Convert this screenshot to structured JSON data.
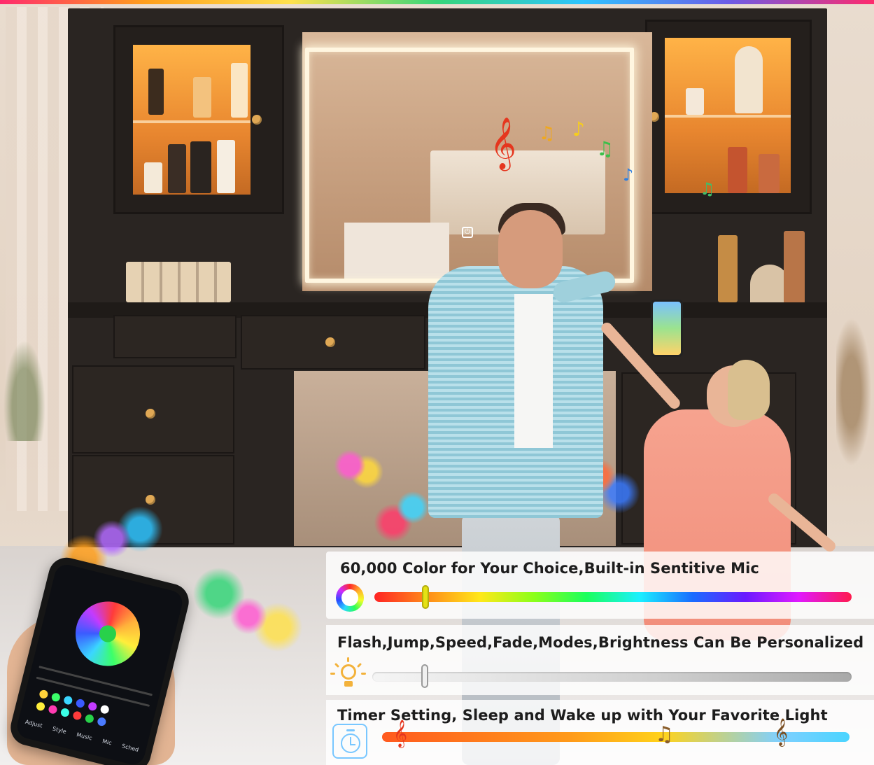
{
  "image": {
    "scene": "vanity-with-led-mirror",
    "accent_colors": [
      "#ff2a6d",
      "#ff9f1c",
      "#ffe14d",
      "#37d67a",
      "#2ec4ff",
      "#6c5ce7"
    ]
  },
  "features": [
    {
      "title": "60,000 Color for Your Choice,Built-in Sentitive Mic",
      "icon": "color-ring-icon",
      "slider_position": 0.11
    },
    {
      "title": "Flash,Jump,Speed,Fade,Modes,Brightness Can Be Personalized",
      "icon": "lightbulb-icon",
      "slider_position": 0.11
    },
    {
      "title": "Timer Setting, Sleep and Wake up with Your Favorite Light",
      "icon": "timer-icon"
    }
  ],
  "phone_app": {
    "tabs": [
      "Adjust",
      "Style",
      "Music",
      "Mic",
      "Sched"
    ]
  }
}
